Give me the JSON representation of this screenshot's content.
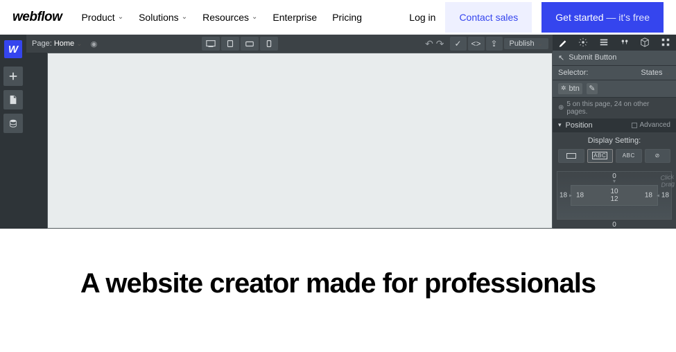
{
  "nav": {
    "logo": "webflow",
    "items": [
      "Product",
      "Solutions",
      "Resources",
      "Enterprise",
      "Pricing"
    ],
    "login": "Log in",
    "contact": "Contact sales",
    "get_started": "Get started",
    "get_started_sub": " — it's free"
  },
  "designer": {
    "page_label": "Page:",
    "page_name": "Home",
    "publish": "Publish"
  },
  "style": {
    "submit_button": "Submit Button",
    "selector": "Selector:",
    "states": "States",
    "selector_value": "btn",
    "count_text": "5 on this page, 24 on other pages.",
    "position": "Position",
    "advanced": "Advanced",
    "display_setting": "Display Setting:",
    "disp_abc": "ABC",
    "spacing": {
      "top_outer": "0",
      "left_outer": "18",
      "right_outer": "18",
      "top_inner": "10",
      "bottom_inner": "12",
      "bottom_outer": "0",
      "hint1": "Click",
      "hint2": "Drag"
    }
  },
  "hero": {
    "headline": "A website creator made for professionals"
  }
}
